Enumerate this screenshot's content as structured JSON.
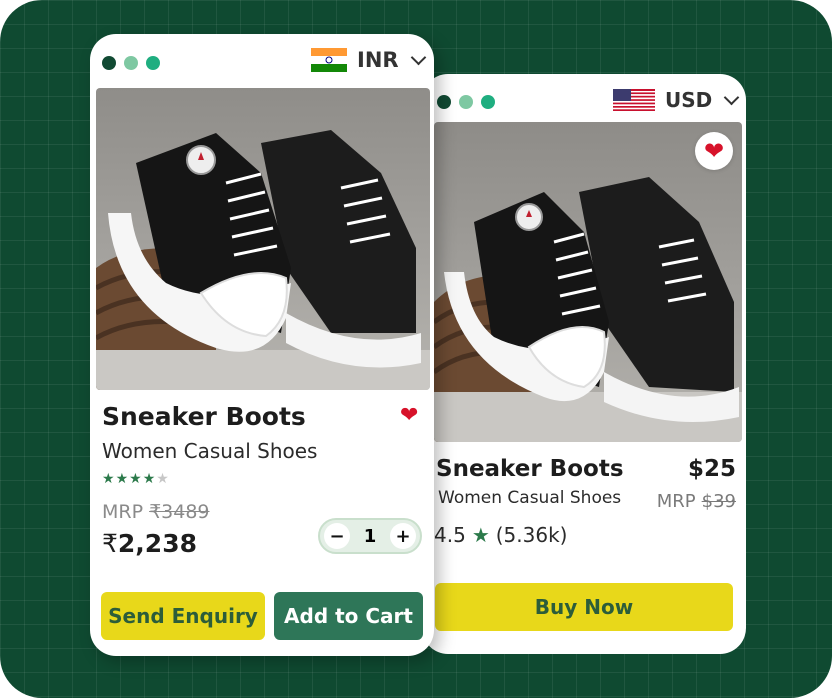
{
  "colors": {
    "background": "#0f4a31",
    "primary_green": "#2e7658",
    "accent_yellow": "#e8d81a",
    "heart_red": "#d7122a",
    "star_green": "#2c7a4b",
    "dot_dark": "#114a33",
    "dot_mid": "#7ec8a2",
    "dot_light": "#1fae80"
  },
  "front_card": {
    "currency": {
      "code": "INR",
      "flag_icon": "india-flag-icon"
    },
    "product": {
      "title": "Sneaker Boots",
      "subtitle": "Women Casual Shoes",
      "rating_stars": 4,
      "rating_max": 5,
      "mrp_label": "MRP",
      "mrp_value": "₹3489",
      "price_symbol": "₹",
      "price_value": "2,238"
    },
    "quantity": {
      "minus": "−",
      "value": "1",
      "plus": "+"
    },
    "buttons": {
      "enquiry": "Send Enquiry",
      "cart": "Add to Cart"
    }
  },
  "back_card": {
    "currency": {
      "code": "USD",
      "flag_icon": "us-flag-icon"
    },
    "product": {
      "title": "Sneaker Boots",
      "subtitle": "Women Casual Shoes",
      "price": "$25",
      "mrp_label": "MRP",
      "mrp_value": "$39",
      "rating_value": "4.5",
      "rating_count": "(5.36k)"
    },
    "buttons": {
      "buy": "Buy Now"
    }
  }
}
